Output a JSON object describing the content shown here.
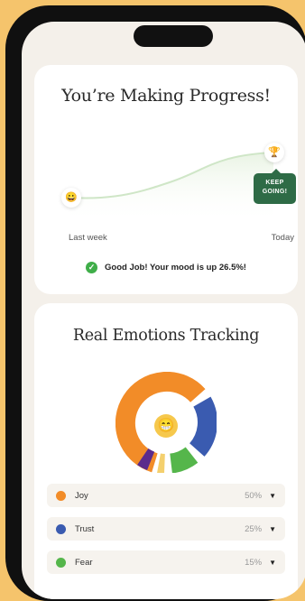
{
  "progress_card": {
    "title": "You’re Making Progress!",
    "badge_line1": "KEEP",
    "badge_line2": "GOING!",
    "start_label": "Last week",
    "end_label": "Today",
    "status_text": "Good Job! Your mood is up 26.5%!",
    "start_icon": "smiley-emoji-icon",
    "end_icon": "trophy-icon",
    "line_color": "#CFE6C7"
  },
  "emotions_card": {
    "title": "Real Emotions Tracking",
    "center_icon": "grinning-emoji-icon",
    "segments_colors": {
      "orange": "#F28C28",
      "blue": "#3A5BB0",
      "green": "#55B64B",
      "yellow": "#F4D06E",
      "purple": "#5B2B8C"
    },
    "items": [
      {
        "label": "Joy",
        "percent": "50%",
        "color": "#F28C28"
      },
      {
        "label": "Trust",
        "percent": "25%",
        "color": "#3A5BB0"
      },
      {
        "label": "Fear",
        "percent": "15%",
        "color": "#55B64B"
      }
    ]
  }
}
